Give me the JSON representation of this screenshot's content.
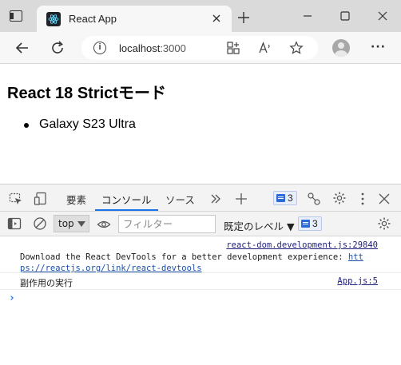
{
  "browser": {
    "tab_title": "React App",
    "url_host": "localhost",
    "url_port": ":3000"
  },
  "page": {
    "heading": "React 18 Strictモード",
    "items": [
      "Galaxy S23 Ultra"
    ]
  },
  "devtools": {
    "tabs": [
      "要素",
      "コンソール",
      "ソース"
    ],
    "active_tab": "コンソール",
    "issues_count": "3",
    "context": "top",
    "filter_placeholder": "フィルター",
    "levels_label": "既定のレベル",
    "levels_count": "3",
    "logs": [
      {
        "source": "react-dom.development.js:29840",
        "message": "Download the React DevTools for a better development experience: ",
        "link_line1": "htt",
        "link_line2": "ps://reactjs.org/link/react-devtools"
      },
      {
        "source": "App.js:5",
        "message": "副作用の実行"
      }
    ],
    "prompt": "›"
  },
  "colors": {
    "accent": "#1a73e8",
    "titlebar": "#dadada",
    "toolbar": "#f7f7f7",
    "devtools_bar": "#f3f3f3"
  }
}
